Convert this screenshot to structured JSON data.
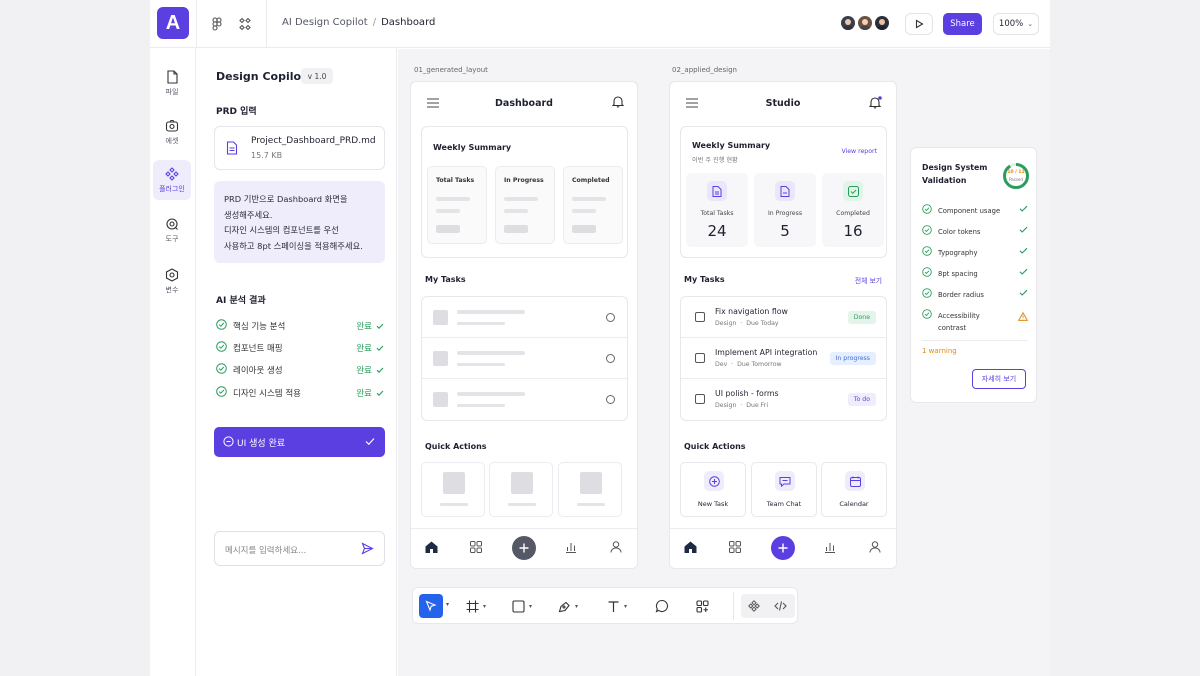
{
  "app": {
    "logo_letter": "A"
  },
  "header": {
    "breadcrumb_root": "AI Design Copilot",
    "breadcrumb_sep": "/",
    "breadcrumb_current": "Dashboard",
    "share_label": "Share",
    "zoom_value": "100%",
    "zoom_chevron": "⌄"
  },
  "rail": {
    "items": [
      {
        "label": "파일",
        "icon": "file-icon"
      },
      {
        "label": "에셋",
        "icon": "asset-icon"
      },
      {
        "label": "플러그인",
        "icon": "plugin-icon"
      },
      {
        "label": "도구",
        "icon": "tools-icon"
      },
      {
        "label": "변수",
        "icon": "variable-icon"
      }
    ]
  },
  "copilot": {
    "title": "Design Copilot",
    "version": "v 1.0",
    "prd_heading": "PRD 입력",
    "file_name": "Project_Dashboard_PRD.md",
    "file_size": "15.7 KB",
    "prompt_lines": [
      "PRD 기반으로 Dashboard 화면을",
      "생성해주세요.",
      "디자인 시스템의 컴포넌트를 우선",
      "사용하고 8pt 스페이싱을 적용해주세요."
    ],
    "analysis_heading": "AI 분석 결과",
    "analysis": [
      {
        "label": "핵심 기능 분석",
        "status": "완료"
      },
      {
        "label": "컴포넌트 매핑",
        "status": "완료"
      },
      {
        "label": "레이아웃 생성",
        "status": "완료"
      },
      {
        "label": "디자인 시스템 적용",
        "status": "완료"
      }
    ],
    "generate_label": "UI 생성 완료",
    "message_placeholder": "메시지를 입력하세요..."
  },
  "canvas": {
    "frame1_label": "01_generated_layout",
    "frame2_label": "02_applied_design",
    "layout": {
      "title": "Dashboard",
      "weekly_summary": "Weekly Summary",
      "stats": [
        "Total Tasks",
        "In Progress",
        "Completed"
      ],
      "my_tasks": "My Tasks",
      "quick_actions": "Quick Actions"
    },
    "studio": {
      "title": "Studio",
      "weekly_summary": "Weekly Summary",
      "weekly_sub": "이번 주 진행 현황",
      "view_report": "View report",
      "stats": [
        {
          "label": "Total Tasks",
          "value": "24"
        },
        {
          "label": "In Progress",
          "value": "5"
        },
        {
          "label": "Completed",
          "value": "16"
        }
      ],
      "my_tasks": "My Tasks",
      "see_all": "전체 보기",
      "tasks": [
        {
          "title": "Fix navigation flow",
          "category": "Design",
          "due": "Due Today",
          "status": "Done"
        },
        {
          "title": "Implement API integration",
          "category": "Dev",
          "due": "Due Tomorrow",
          "status": "In progress"
        },
        {
          "title": "UI polish - forms",
          "category": "Design",
          "due": "Due Fri",
          "status": "To do"
        }
      ],
      "quick_actions": "Quick Actions",
      "actions": [
        "New Task",
        "Team Chat",
        "Calendar"
      ]
    },
    "validation": {
      "title_line1": "Design System",
      "title_line2": "Validation",
      "score": "10 / 11",
      "score_label": "Passed",
      "score_fraction": 0.909,
      "checks": [
        {
          "label": "Component usage",
          "state": "pass"
        },
        {
          "label": "Color tokens",
          "state": "pass"
        },
        {
          "label": "Typography",
          "state": "pass"
        },
        {
          "label": "8pt spacing",
          "state": "pass"
        },
        {
          "label": "Border radius",
          "state": "pass"
        },
        {
          "label": "Accessibility contrast",
          "state": "warning"
        }
      ],
      "warning_text": "1 warning",
      "detail_label": "자세히 보기"
    }
  },
  "colors": {
    "accent": "#5b3fe0",
    "success": "#2a9d5c",
    "warning": "#e08a10",
    "selected_tool": "#2563eb"
  }
}
